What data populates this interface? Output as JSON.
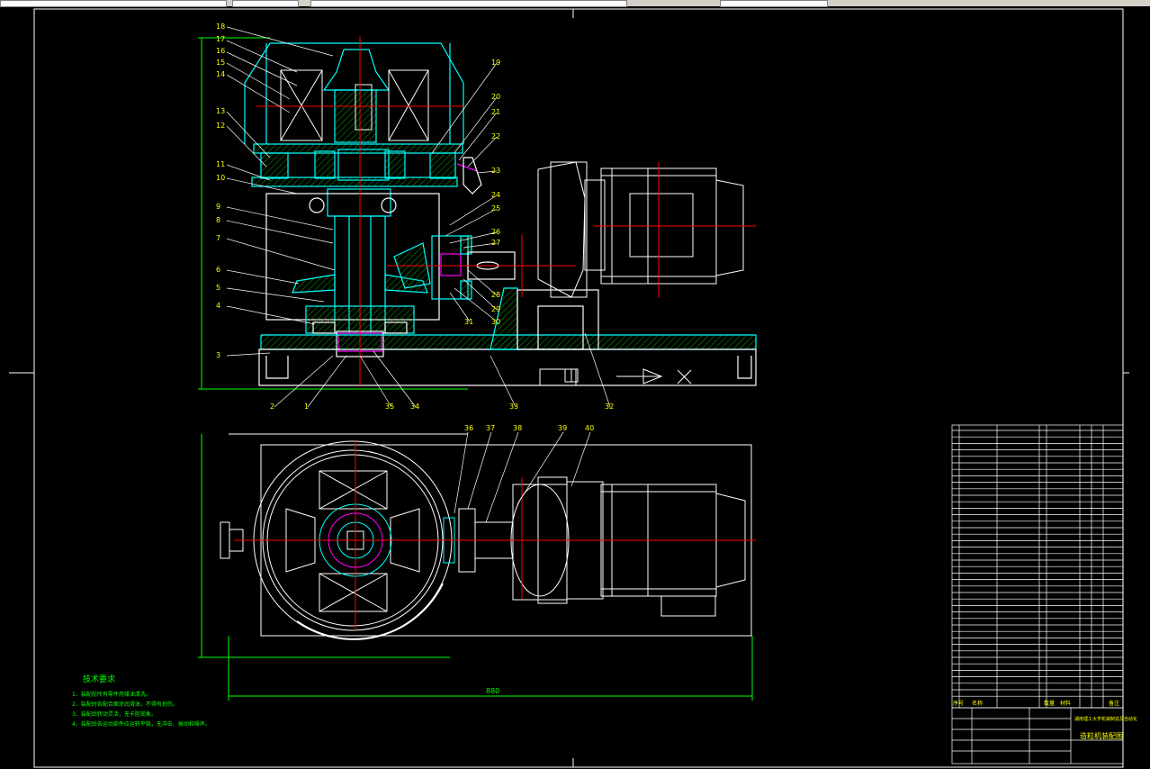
{
  "notes": {
    "title": "技术要求",
    "lines": [
      "1、装配前所有零件用煤油清洗。",
      "2、装配时各配合面涂润滑油，不得有划伤。",
      "3、装配后转动灵活，无卡阻现象。",
      "4、装配后各运动部件应运转平稳，无冲击、振动和噪声。"
    ]
  },
  "dimension": {
    "overall_length": "880"
  },
  "title_block": {
    "school": "湖南理工大学机械制造及自动化",
    "drawing_title": "造粒机装配图",
    "header": [
      "序号",
      "名称",
      "数量",
      "材料",
      "备注"
    ]
  },
  "callouts_left": [
    "18",
    "17",
    "16",
    "15",
    "14",
    "13",
    "12",
    "11",
    "10",
    "9",
    "8",
    "7",
    "6",
    "5",
    "4",
    "3"
  ],
  "callouts_bottom": [
    "2",
    "1",
    "35",
    "34",
    "33",
    "32"
  ],
  "callouts_right": [
    "19",
    "20",
    "21",
    "22",
    "23",
    "24",
    "25",
    "26",
    "27",
    "28",
    "29",
    "30",
    "31"
  ],
  "callouts_plan": [
    "36",
    "37",
    "38",
    "39",
    "40"
  ],
  "colors": {
    "background": "#000000",
    "lines": "#ffffff",
    "section": "#00ffff",
    "centerline": "#ff0000",
    "text": "#ffff00",
    "notes": "#00ff00",
    "hatch": "#00aa00",
    "bolt": "#ff00ff"
  }
}
